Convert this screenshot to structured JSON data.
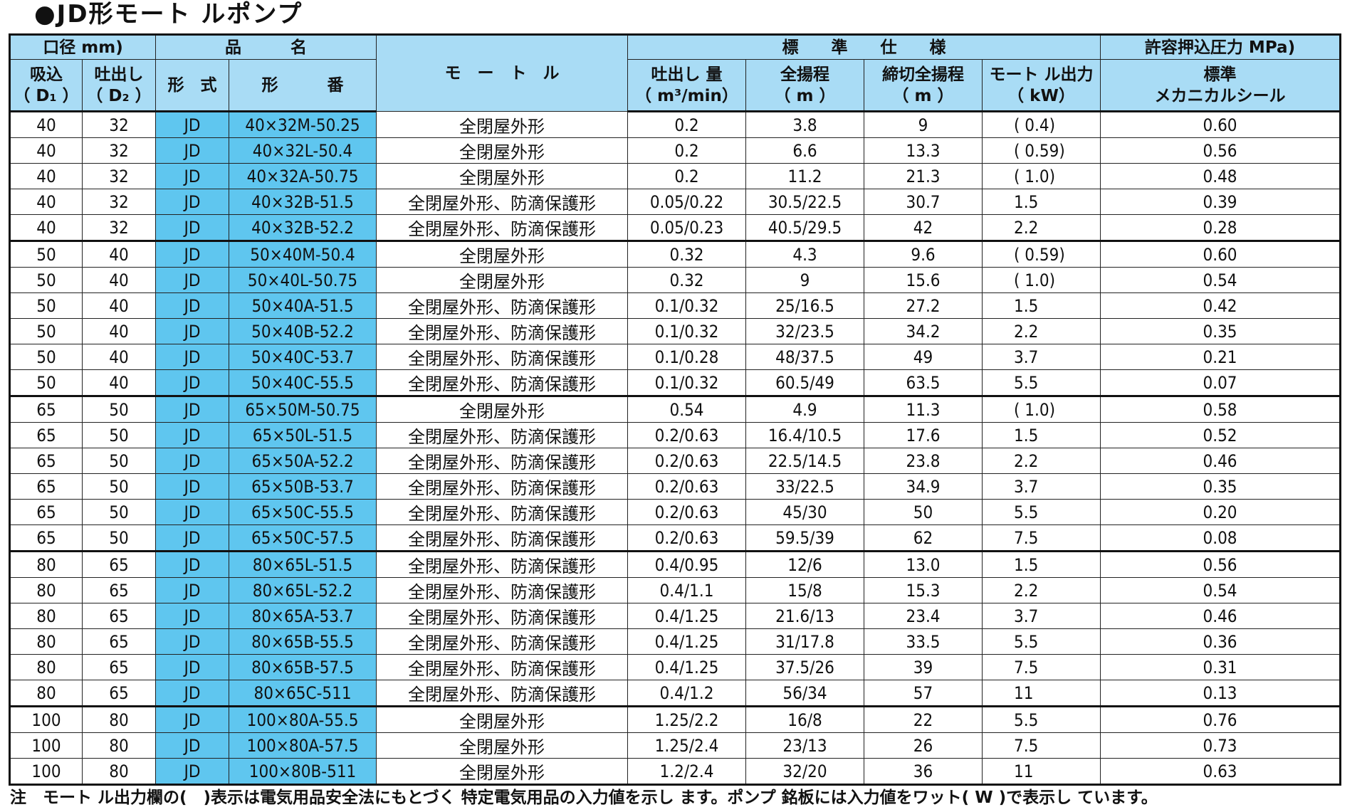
{
  "title": "●JD形モート ルポンプ",
  "header": {
    "bore": "口径 mm)",
    "product_name": "品　　　名",
    "motor": "モ　ー　ト　ル",
    "standard_spec": "標　　準　　仕　　様",
    "allowable_pressure": "許容押込圧力 MPa)",
    "suction": [
      "吸込",
      "（ D₁ ）"
    ],
    "discharge": [
      "吐出し",
      "（ D₂ ）"
    ],
    "type": "形　式",
    "model": "形　　　番",
    "flow": [
      "吐出し 量",
      "（ m³/min）"
    ],
    "total_head": [
      "全揚程",
      "（ m ）"
    ],
    "shutoff_head": [
      "締切全揚程",
      "（ m ）"
    ],
    "motor_output": [
      "モート ル出力",
      "（ kW）"
    ],
    "standard": [
      "標準",
      "メカニカルシール"
    ]
  },
  "rows": [
    {
      "d1": "40",
      "d2": "32",
      "type": "JD",
      "model": "40×32M-50.25",
      "motor": "全閉屋外形",
      "flow": "0.2",
      "head": "3.8",
      "shutoff": "9",
      "kw": "( 0.4)",
      "mpa": "0.60"
    },
    {
      "d1": "40",
      "d2": "32",
      "type": "JD",
      "model": "40×32L-50.4",
      "motor": "全閉屋外形",
      "flow": "0.2",
      "head": "6.6",
      "shutoff": "13.3",
      "kw": "( 0.59)",
      "mpa": "0.56"
    },
    {
      "d1": "40",
      "d2": "32",
      "type": "JD",
      "model": "40×32A-50.75",
      "motor": "全閉屋外形",
      "flow": "0.2",
      "head": "11.2",
      "shutoff": "21.3",
      "kw": "( 1.0)",
      "mpa": "0.48"
    },
    {
      "d1": "40",
      "d2": "32",
      "type": "JD",
      "model": "40×32B-51.5",
      "motor": "全閉屋外形、防滴保護形",
      "flow": "0.05/0.22",
      "head": "30.5/22.5",
      "shutoff": "30.7",
      "kw": "1.5",
      "mpa": "0.39"
    },
    {
      "d1": "40",
      "d2": "32",
      "type": "JD",
      "model": "40×32B-52.2",
      "motor": "全閉屋外形、防滴保護形",
      "flow": "0.05/0.23",
      "head": "40.5/29.5",
      "shutoff": "42",
      "kw": "2.2",
      "mpa": "0.28"
    },
    {
      "d1": "50",
      "d2": "40",
      "type": "JD",
      "model": "50×40M-50.4",
      "motor": "全閉屋外形",
      "flow": "0.32",
      "head": "4.3",
      "shutoff": "9.6",
      "kw": "( 0.59)",
      "mpa": "0.60"
    },
    {
      "d1": "50",
      "d2": "40",
      "type": "JD",
      "model": "50×40L-50.75",
      "motor": "全閉屋外形",
      "flow": "0.32",
      "head": "9",
      "shutoff": "15.6",
      "kw": "( 1.0)",
      "mpa": "0.54"
    },
    {
      "d1": "50",
      "d2": "40",
      "type": "JD",
      "model": "50×40A-51.5",
      "motor": "全閉屋外形、防滴保護形",
      "flow": "0.1/0.32",
      "head": "25/16.5",
      "shutoff": "27.2",
      "kw": "1.5",
      "mpa": "0.42"
    },
    {
      "d1": "50",
      "d2": "40",
      "type": "JD",
      "model": "50×40B-52.2",
      "motor": "全閉屋外形、防滴保護形",
      "flow": "0.1/0.32",
      "head": "32/23.5",
      "shutoff": "34.2",
      "kw": "2.2",
      "mpa": "0.35"
    },
    {
      "d1": "50",
      "d2": "40",
      "type": "JD",
      "model": "50×40C-53.7",
      "motor": "全閉屋外形、防滴保護形",
      "flow": "0.1/0.28",
      "head": "48/37.5",
      "shutoff": "49",
      "kw": "3.7",
      "mpa": "0.21"
    },
    {
      "d1": "50",
      "d2": "40",
      "type": "JD",
      "model": "50×40C-55.5",
      "motor": "全閉屋外形、防滴保護形",
      "flow": "0.1/0.32",
      "head": "60.5/49",
      "shutoff": "63.5",
      "kw": "5.5",
      "mpa": "0.07"
    },
    {
      "d1": "65",
      "d2": "50",
      "type": "JD",
      "model": "65×50M-50.75",
      "motor": "全閉屋外形",
      "flow": "0.54",
      "head": "4.9",
      "shutoff": "11.3",
      "kw": "( 1.0)",
      "mpa": "0.58"
    },
    {
      "d1": "65",
      "d2": "50",
      "type": "JD",
      "model": "65×50L-51.5",
      "motor": "全閉屋外形、防滴保護形",
      "flow": "0.2/0.63",
      "head": "16.4/10.5",
      "shutoff": "17.6",
      "kw": "1.5",
      "mpa": "0.52"
    },
    {
      "d1": "65",
      "d2": "50",
      "type": "JD",
      "model": "65×50A-52.2",
      "motor": "全閉屋外形、防滴保護形",
      "flow": "0.2/0.63",
      "head": "22.5/14.5",
      "shutoff": "23.8",
      "kw": "2.2",
      "mpa": "0.46"
    },
    {
      "d1": "65",
      "d2": "50",
      "type": "JD",
      "model": "65×50B-53.7",
      "motor": "全閉屋外形、防滴保護形",
      "flow": "0.2/0.63",
      "head": "33/22.5",
      "shutoff": "34.9",
      "kw": "3.7",
      "mpa": "0.35"
    },
    {
      "d1": "65",
      "d2": "50",
      "type": "JD",
      "model": "65×50C-55.5",
      "motor": "全閉屋外形、防滴保護形",
      "flow": "0.2/0.63",
      "head": "45/30",
      "shutoff": "50",
      "kw": "5.5",
      "mpa": "0.20"
    },
    {
      "d1": "65",
      "d2": "50",
      "type": "JD",
      "model": "65×50C-57.5",
      "motor": "全閉屋外形、防滴保護形",
      "flow": "0.2/0.63",
      "head": "59.5/39",
      "shutoff": "62",
      "kw": "7.5",
      "mpa": "0.08"
    },
    {
      "d1": "80",
      "d2": "65",
      "type": "JD",
      "model": "80×65L-51.5",
      "motor": "全閉屋外形、防滴保護形",
      "flow": "0.4/0.95",
      "head": "12/6",
      "shutoff": "13.0",
      "kw": "1.5",
      "mpa": "0.56"
    },
    {
      "d1": "80",
      "d2": "65",
      "type": "JD",
      "model": "80×65L-52.2",
      "motor": "全閉屋外形、防滴保護形",
      "flow": "0.4/1.1",
      "head": "15/8",
      "shutoff": "15.3",
      "kw": "2.2",
      "mpa": "0.54"
    },
    {
      "d1": "80",
      "d2": "65",
      "type": "JD",
      "model": "80×65A-53.7",
      "motor": "全閉屋外形、防滴保護形",
      "flow": "0.4/1.25",
      "head": "21.6/13",
      "shutoff": "23.4",
      "kw": "3.7",
      "mpa": "0.46"
    },
    {
      "d1": "80",
      "d2": "65",
      "type": "JD",
      "model": "80×65B-55.5",
      "motor": "全閉屋外形、防滴保護形",
      "flow": "0.4/1.25",
      "head": "31/17.8",
      "shutoff": "33.5",
      "kw": "5.5",
      "mpa": "0.36"
    },
    {
      "d1": "80",
      "d2": "65",
      "type": "JD",
      "model": "80×65B-57.5",
      "motor": "全閉屋外形、防滴保護形",
      "flow": "0.4/1.25",
      "head": "37.5/26",
      "shutoff": "39",
      "kw": "7.5",
      "mpa": "0.31"
    },
    {
      "d1": "80",
      "d2": "65",
      "type": "JD",
      "model": "80×65C-511",
      "motor": "全閉屋外形、防滴保護形",
      "flow": "0.4/1.2",
      "head": "56/34",
      "shutoff": "57",
      "kw": "11",
      "mpa": "0.13"
    },
    {
      "d1": "100",
      "d2": "80",
      "type": "JD",
      "model": "100×80A-55.5",
      "motor": "全閉屋外形",
      "flow": "1.25/2.2",
      "head": "16/8",
      "shutoff": "22",
      "kw": "5.5",
      "mpa": "0.76"
    },
    {
      "d1": "100",
      "d2": "80",
      "type": "JD",
      "model": "100×80A-57.5",
      "motor": "全閉屋外形",
      "flow": "1.25/2.4",
      "head": "23/13",
      "shutoff": "26",
      "kw": "7.5",
      "mpa": "0.73"
    },
    {
      "d1": "100",
      "d2": "80",
      "type": "JD",
      "model": "100×80B-511",
      "motor": "全閉屋外形",
      "flow": "1.2/2.4",
      "head": "32/20",
      "shutoff": "36",
      "kw": "11",
      "mpa": "0.63"
    }
  ],
  "note": "注　モート ル出力欄の(　)表示は電気用品安全法にもとづく 特定電気用品の入力値を示し ます。ポンプ 銘板には入力値をワット( W )で表示し ています。",
  "colors": {
    "header_bg": "#a9dcf5",
    "model_bg": "#5fc6ef",
    "border": "#111111"
  }
}
